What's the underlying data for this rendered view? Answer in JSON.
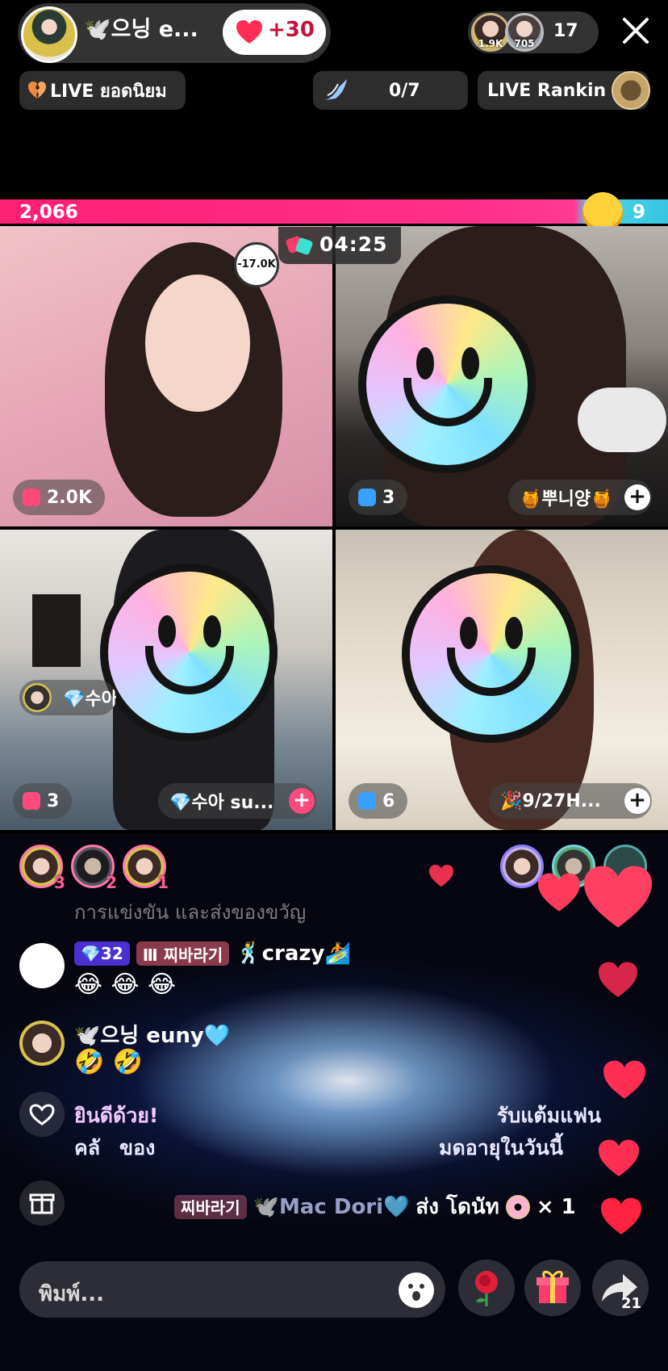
{
  "header": {
    "host_name": "🕊️으닝 e...",
    "like_badge": "+30",
    "viewer_avatars": [
      "1.9K",
      "705"
    ],
    "viewer_count": "17"
  },
  "chips": {
    "live_popular": "LIVE ยอดนิยม",
    "goal": "0/7",
    "ranking": "LIVE Rankin"
  },
  "battle": {
    "score_left": "2,066",
    "score_right": "9",
    "timer": "04:25"
  },
  "tiles": [
    {
      "badge": "2.0K",
      "badge_color": "#ff4a7d",
      "overlay_text": "-17.0K"
    },
    {
      "badge": "3",
      "badge_color": "#3aa0ff",
      "name": "🍯뿌니양🍯"
    },
    {
      "badge": "3",
      "badge_color": "#ff4a7d",
      "name": "💎수아 su...",
      "side_name": "💎수아"
    },
    {
      "badge": "6",
      "badge_color": "#3aa0ff",
      "name": "🎉9/27H..."
    }
  ],
  "top_gifters": [
    "3",
    "2",
    "1"
  ],
  "chat": {
    "faded": "การแข่งขัน และส่งของขวัญ",
    "messages": [
      {
        "level": "💎32",
        "fan": "Ⅲ 찌바라기",
        "name": "🕺crazy🏄",
        "emojis": "😂 😂 😂"
      },
      {
        "name": "🕊️으닝 euny🩵",
        "emojis": "🤣 🤣"
      }
    ],
    "system": [
      "ยินดีด้วย!",
      "รับแต้มแฟน",
      "คลั",
      "ของ",
      "มดอายุในวันนี้"
    ],
    "gift_line": {
      "fan": "찌바라기",
      "name": "🕊️Mac Dori🩵",
      "action": "ส่ง โดนัท",
      "qty": "× 1"
    }
  },
  "bottom": {
    "placeholder": "พิมพ์...",
    "share_count": "21"
  }
}
